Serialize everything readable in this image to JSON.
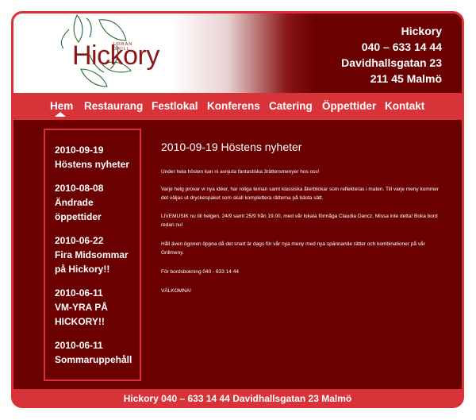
{
  "brand": {
    "logo_text": "Hickory",
    "logo_sub": "URBAN GRILL"
  },
  "contact": {
    "name": "Hickory",
    "phone": "040 – 633 14 44",
    "street": "Davidhallsgatan 23",
    "city": "211 45 Malmö"
  },
  "nav": {
    "items": [
      "Hem",
      "Restaurang",
      "Festlokal",
      "Konferens",
      "Catering",
      "Öppettider",
      "Kontakt"
    ]
  },
  "sidebar": {
    "items": [
      {
        "date": "2010-09-19",
        "title": "Höstens nyheter"
      },
      {
        "date": "2010-08-08",
        "title": "Ändrade öppettider"
      },
      {
        "date": "2010-06-22",
        "title": "Fira Midsommar på Hickory!!"
      },
      {
        "date": "2010-06-11",
        "title": "VM-YRA PÅ HICKORY!!"
      },
      {
        "date": "2010-06-11",
        "title": "Sommaruppehåll"
      }
    ]
  },
  "article": {
    "heading": "2010-09-19 Höstens nyheter",
    "paragraphs": [
      "Under hela hösten kan ni avnjuta fantastiska 3rättersmenyer hos oss!",
      "Varje helg provar vi nya idéer, har roliga teman samt klassiska återblickar som reflekteras i maten. Till varje meny kommer det väljas ut dryckespaket som skall komplettera rätterna på bästa sätt.",
      "LIVEMUSIK nu till helgen, 24/9 samt 25/9 från 19.00, med vår lokala förmåga Claudia Dancz. Missa inte detta! Boka bord redan nu!",
      "Håll även ögonen öppna då det snart är dags för vår nya meny med nya spännande rätter och kombinationer på vår Grillmeny.",
      "För bordsbokning 040 - 633 14 44",
      "VÄLKOMNA!"
    ]
  },
  "footer": {
    "text": "Hickory 040 – 633 14 44 Davidhallsgatan 23 Malmö"
  },
  "colors": {
    "background": "#6b0000",
    "accent": "#d9333a",
    "logo": "#8b1616"
  }
}
